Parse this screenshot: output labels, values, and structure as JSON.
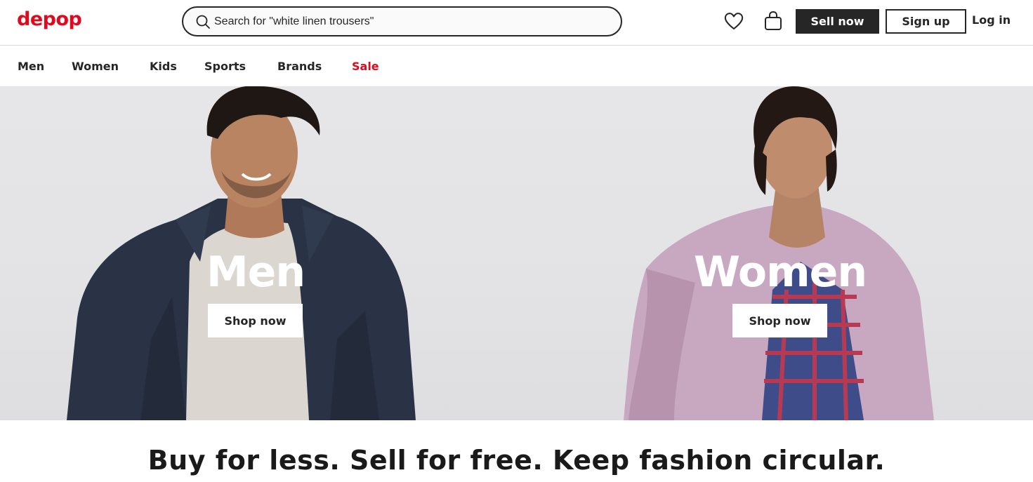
{
  "brand": {
    "logo_text": "depop",
    "color": "#e00a1f"
  },
  "header": {
    "search_placeholder": "Search for \"white linen trousers\"",
    "search_icon": "search-icon",
    "wishlist_icon": "heart-icon",
    "bag_icon": "shopping-bag-icon",
    "sell_label": "Sell now",
    "signup_label": "Sign up",
    "login_label": "Log in"
  },
  "nav": {
    "items": [
      {
        "label": "Men"
      },
      {
        "label": "Women"
      },
      {
        "label": "Kids"
      },
      {
        "label": "Sports"
      },
      {
        "label": "Brands"
      },
      {
        "label": "Sale",
        "accent": "#e00a1f"
      }
    ]
  },
  "hero": {
    "panels": [
      {
        "title": "Men",
        "button_label": "Shop now"
      },
      {
        "title": "Women",
        "button_label": "Shop now"
      }
    ]
  },
  "tagline": "Buy for less. Sell for free. Keep fashion circular."
}
